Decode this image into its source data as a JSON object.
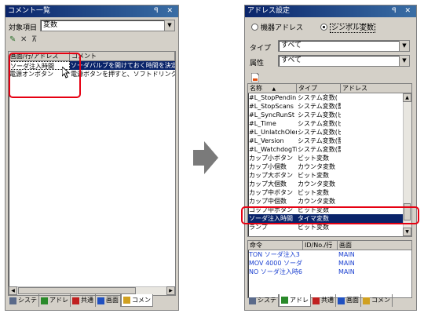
{
  "left_panel": {
    "title": "コメント一覧",
    "title_buttons": "ꟼ ✕",
    "target_label": "対象項目",
    "target_value": "変数",
    "toolbar_icons": [
      "edit-icon",
      "delete-icon",
      "filter-icon"
    ],
    "columns": [
      "画面/行/アドレス",
      "コメント"
    ],
    "rows": [
      {
        "name": "ソーダ注入時間",
        "comment": "ソーダバルブを開けておく時間を決定します"
      },
      {
        "name": "電源オンボタン",
        "comment": "電源ボタンを押すと、ソフトドリンクサーバの"
      }
    ],
    "tabs": [
      "システ",
      "アドレ",
      "共通",
      "画面",
      "コメン"
    ]
  },
  "right_panel": {
    "title": "アドレス設定",
    "title_buttons": "ꟼ ✕",
    "radio_device": "機器アドレス",
    "radio_symbol": "シンボル変数",
    "type_label": "タイプ",
    "type_value": "すべて",
    "attr_label": "属性",
    "attr_value": "すべて",
    "columns": [
      "名称",
      "タイプ",
      "アドレス"
    ],
    "rows": [
      {
        "name": "#L_StopPendin",
        "type": "システム変数("
      },
      {
        "name": "#L_StopScans",
        "type": "システム変数(整"
      },
      {
        "name": "#L_SyncRunSt",
        "type": "システム変数(ビ"
      },
      {
        "name": "#L_Time",
        "type": "システム変数(ビ"
      },
      {
        "name": "#L_UnlatchOler",
        "type": "システム変数(ビ"
      },
      {
        "name": "#L_Version",
        "type": "システム変数(整"
      },
      {
        "name": "#L_WatchdogTi",
        "type": "システム変数(整"
      },
      {
        "name": "カップ小ボタン",
        "type": "ビット変数"
      },
      {
        "name": "カップ小個数",
        "type": "カウンタ変数"
      },
      {
        "name": "カップ大ボタン",
        "type": "ビット変数"
      },
      {
        "name": "カップ大個数",
        "type": "カウンタ変数"
      },
      {
        "name": "カップ中ボタン",
        "type": "ビット変数"
      },
      {
        "name": "カップ中個数",
        "type": "カウンタ変数"
      },
      {
        "name": "コップ中ボタン",
        "type": "ビット変数"
      },
      {
        "name": "ソーダ注入時間",
        "type": "タイマ変数"
      },
      {
        "name": "ランプ",
        "type": "ビット変数"
      }
    ],
    "ref_columns": [
      "命令",
      "ID/No./行",
      "画面"
    ],
    "ref_rows": [
      {
        "cmd": "TON ソーダ注入3",
        "id": "",
        "screen": "MAIN"
      },
      {
        "cmd": "MOV 4000 ソーダ",
        "id": "",
        "screen": "MAIN"
      },
      {
        "cmd": "NO ソーダ注入時6",
        "id": "",
        "screen": "MAIN"
      }
    ],
    "tabs": [
      "システ",
      "アドレ",
      "共通",
      "画面",
      "コメン"
    ]
  }
}
